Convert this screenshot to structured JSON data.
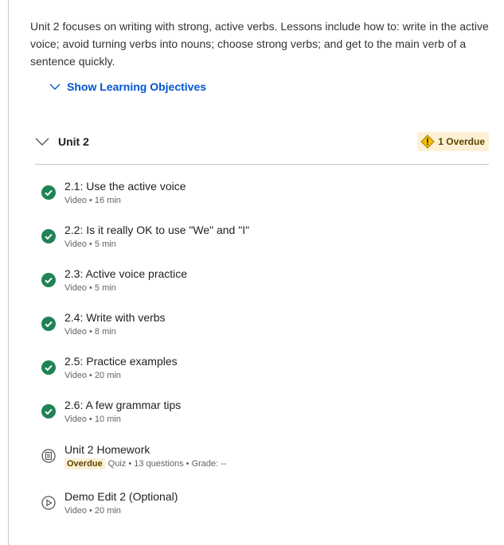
{
  "description": "Unit 2 focuses on writing with strong, active verbs. Lessons include how to: write in the active voice; avoid turning verbs into nouns; choose strong verbs; and get to the main verb of a sentence quickly.",
  "learning_objectives_toggle": "Show Learning Objectives",
  "unit": {
    "title": "Unit 2",
    "overdue_badge": "1 Overdue"
  },
  "items": [
    {
      "title": "2.1: Use the active voice",
      "meta": "Video • 16 min",
      "status": "completed"
    },
    {
      "title": "2.2: Is it really OK to use \"We\" and \"I\"",
      "meta": "Video • 5 min",
      "status": "completed"
    },
    {
      "title": "2.3: Active voice practice",
      "meta": "Video • 5 min",
      "status": "completed"
    },
    {
      "title": "2.4: Write with verbs",
      "meta": "Video • 8 min",
      "status": "completed"
    },
    {
      "title": "2.5: Practice examples",
      "meta": "Video • 20 min",
      "status": "completed"
    },
    {
      "title": "2.6: A few grammar tips",
      "meta": "Video • 10 min",
      "status": "completed"
    },
    {
      "title": "Unit 2 Homework",
      "tag": "Overdue",
      "meta": "Quiz • 13 questions • Grade: --",
      "status": "quiz"
    },
    {
      "title": "Demo Edit 2 (Optional)",
      "meta": "Video • 20 min",
      "status": "video"
    }
  ],
  "colors": {
    "completed": "#1f8354",
    "link": "#0056d2",
    "overdue_bg": "#fdf0d5",
    "warning": "#f5c000"
  },
  "icons": {
    "completed": "check-circle-icon",
    "quiz": "quiz-icon",
    "video": "play-circle-icon",
    "chevron": "chevron-down-icon",
    "warning": "warning-diamond-icon"
  }
}
